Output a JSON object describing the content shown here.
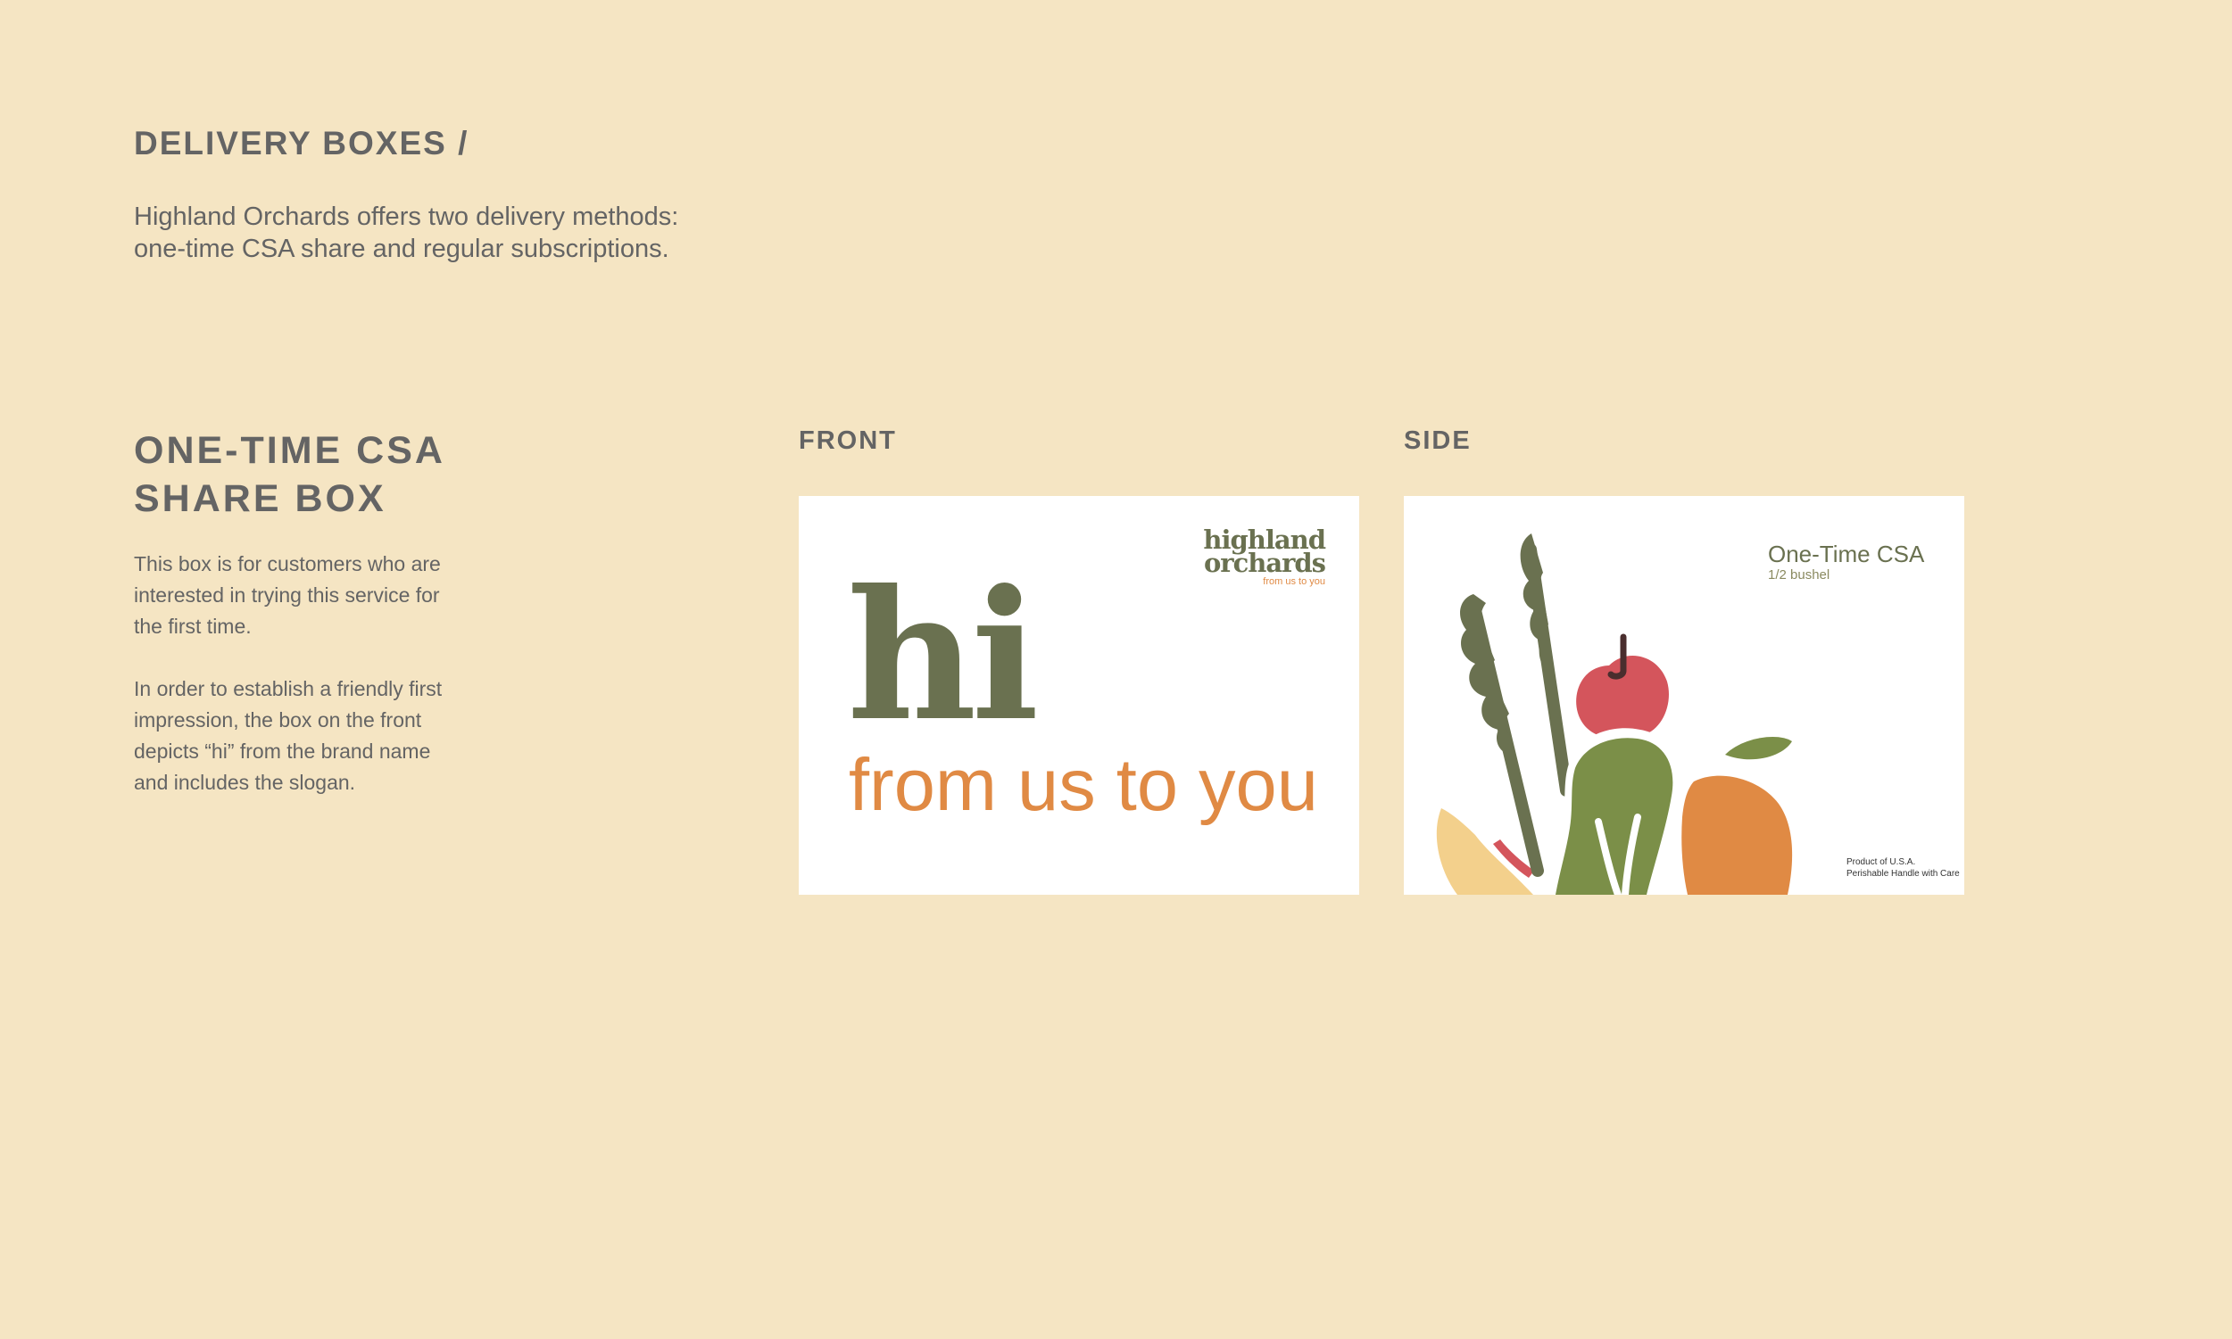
{
  "header": {
    "title": "DELIVERY BOXES /",
    "intro_line1": "Highland Orchards offers two delivery methods:",
    "intro_line2": "one-time CSA share and regular subscriptions."
  },
  "box": {
    "title_line1": "ONE-TIME CSA",
    "title_line2": "SHARE BOX",
    "para1": [
      "This box is for customers who are",
      "interested in trying this service for",
      "the first time."
    ],
    "para2": [
      "In order to establish a friendly first",
      "impression, the box on the front",
      "depicts “hi” from the brand name",
      "and includes the slogan."
    ]
  },
  "front": {
    "label": "FRONT",
    "logo_line1": "highland",
    "logo_line2": "orchards",
    "logo_tagline": "from us to you",
    "greeting": "hi",
    "slogan": "from us to you"
  },
  "side": {
    "label": "SIDE",
    "product_name": "One-Time CSA",
    "product_size": "1/2 bushel",
    "origin_line1": "Product of U.S.A.",
    "origin_line2": "Perishable Handle with Care",
    "illustration_icon": "produce-illustration"
  },
  "colors": {
    "background": "#f5e5c3",
    "text_gray": "#646464",
    "olive": "#6a7150",
    "orange": "#e08a44",
    "apple_red": "#d4555c",
    "leaf_green": "#7b8f48",
    "squash_yellow": "#f3d08c"
  }
}
